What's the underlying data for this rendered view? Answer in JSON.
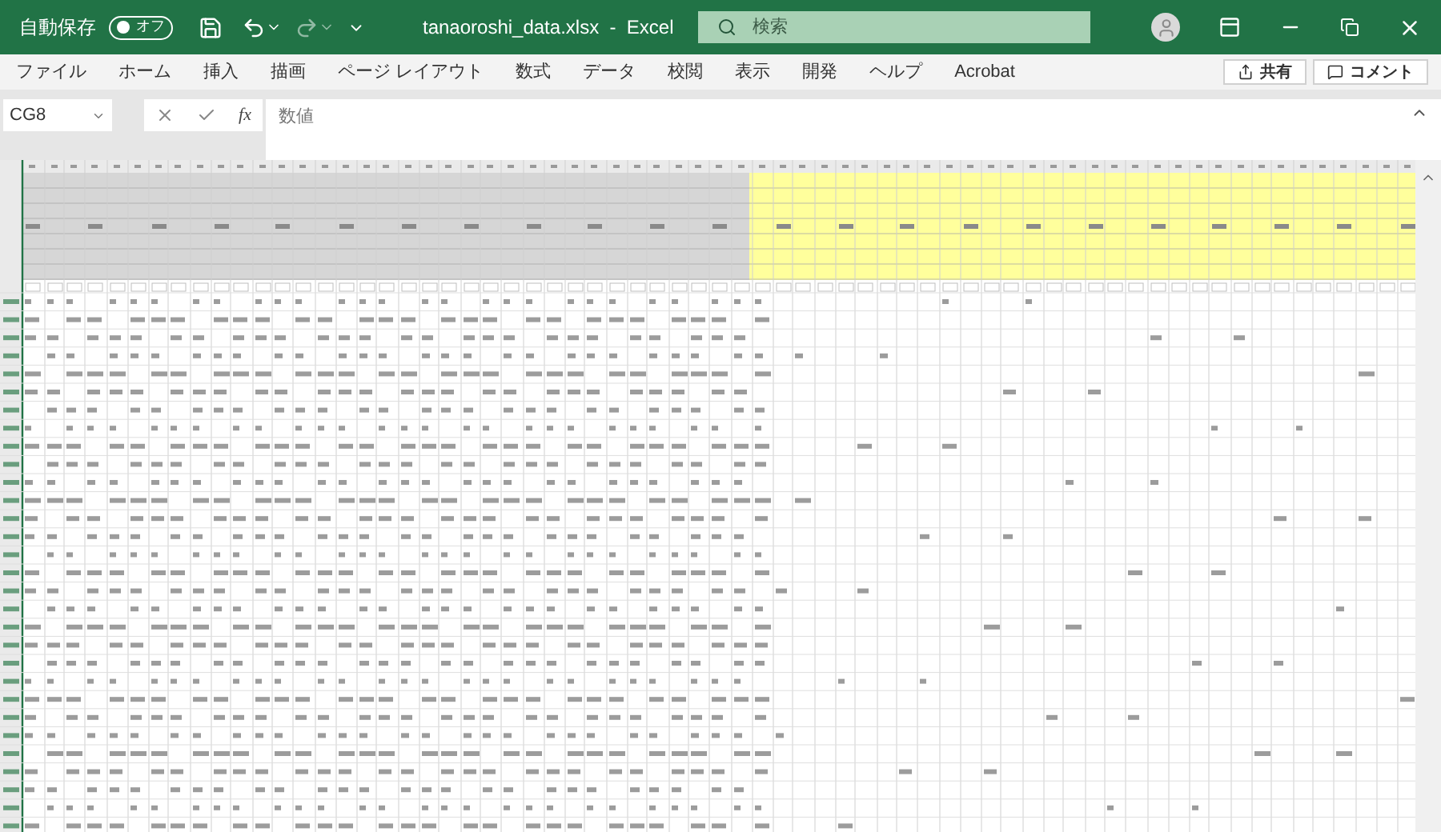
{
  "title_bar": {
    "autosave_label": "自動保存",
    "autosave": {
      "on": false,
      "label": "オフ"
    },
    "title": "tanaoroshi_data.xlsx  -  Excel",
    "search": {
      "placeholder": "検索"
    }
  },
  "menu": {
    "tabs": [
      "ファイル",
      "ホーム",
      "挿入",
      "描画",
      "ページ レイアウト",
      "数式",
      "データ",
      "校閲",
      "表示",
      "開発",
      "ヘルプ",
      "Acrobat"
    ],
    "share_button": "共有",
    "comment_button": "コメント"
  },
  "formula_bar": {
    "name_box": "CG8",
    "function_label": "fx",
    "value": "数値"
  }
}
